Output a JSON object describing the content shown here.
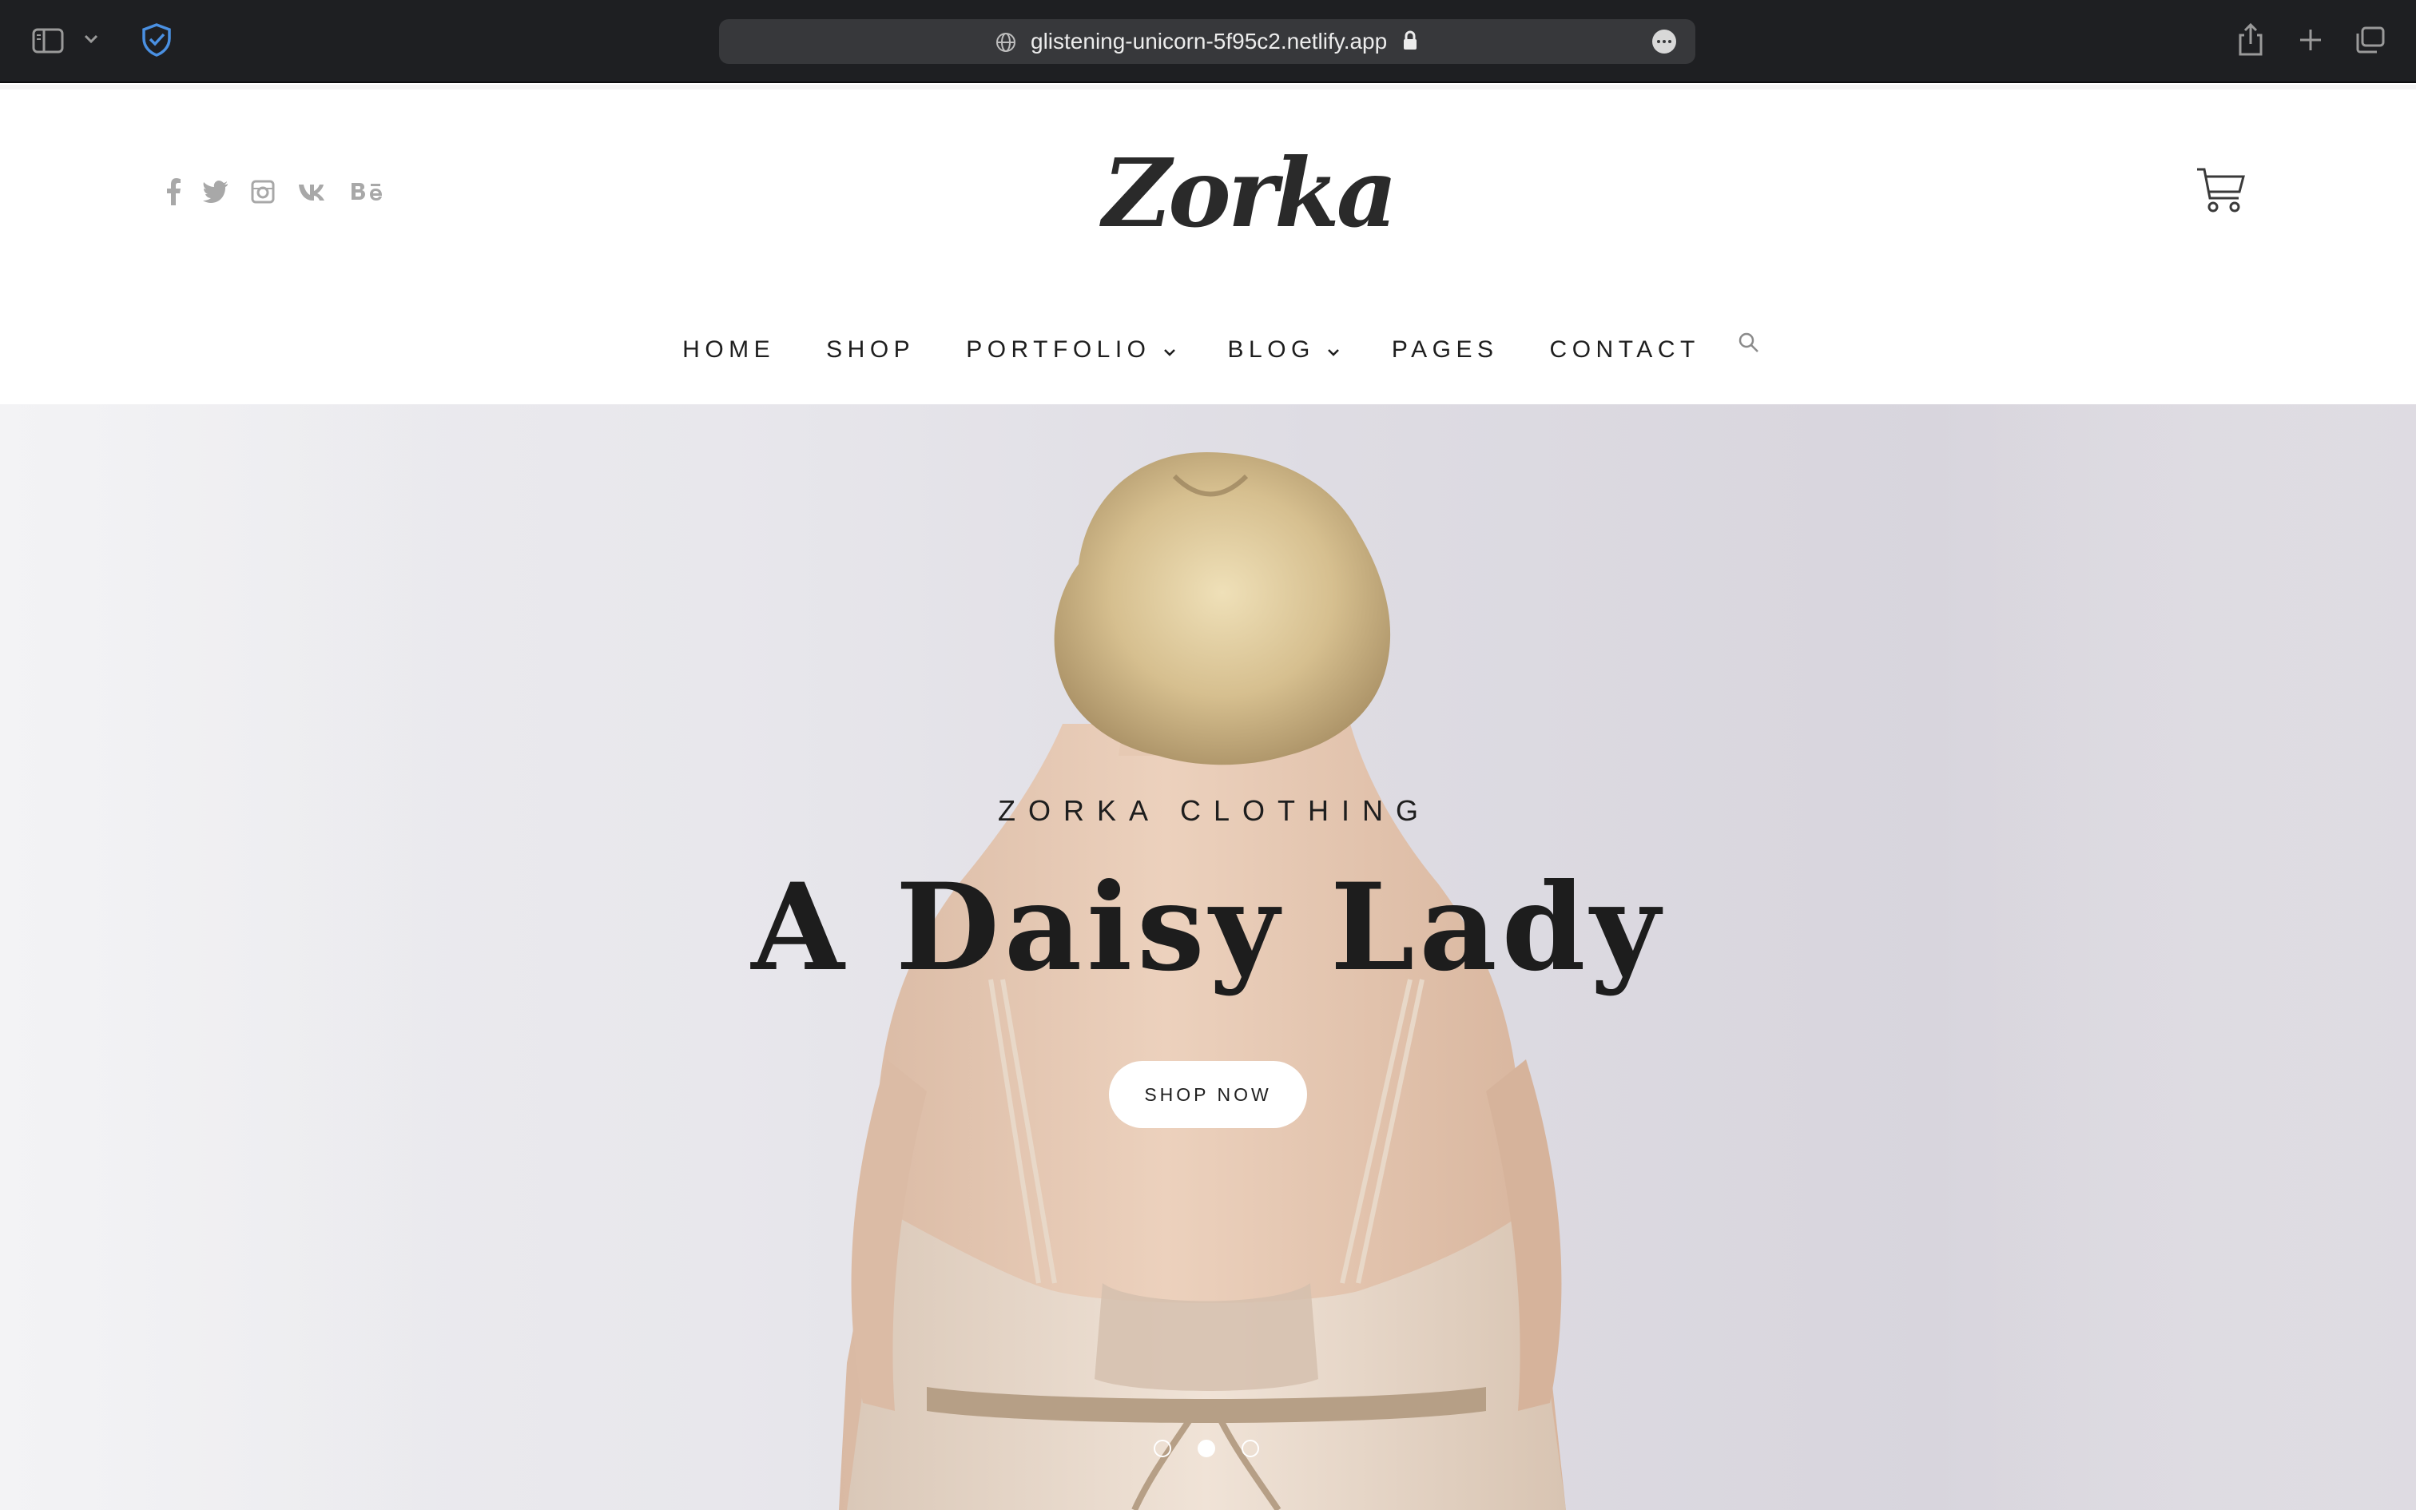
{
  "browser": {
    "url": "glistening-unicorn-5f95c2.netlify.app",
    "icons": [
      "sidebar-icon",
      "chevron-down-icon",
      "shield-check-icon",
      "globe-icon",
      "lock-icon",
      "more-icon",
      "share-icon",
      "new-tab-icon",
      "tabs-icon"
    ]
  },
  "header": {
    "logo": "Zorka",
    "socials": [
      {
        "name": "facebook-icon",
        "glyph": "f"
      },
      {
        "name": "twitter-icon",
        "glyph": "🐦"
      },
      {
        "name": "instagram-icon",
        "glyph": "◻"
      },
      {
        "name": "vk-icon",
        "glyph": "vk"
      },
      {
        "name": "behance-icon",
        "glyph": "Bē"
      }
    ],
    "cart_icon": "cart-icon"
  },
  "nav": {
    "items": [
      {
        "label": "HOME",
        "has_dropdown": false
      },
      {
        "label": "SHOP",
        "has_dropdown": false
      },
      {
        "label": "PORTFOLIO",
        "has_dropdown": true
      },
      {
        "label": "BLOG",
        "has_dropdown": true
      },
      {
        "label": "PAGES",
        "has_dropdown": false
      },
      {
        "label": "CONTACT",
        "has_dropdown": false
      }
    ],
    "search_icon": "search-icon"
  },
  "hero": {
    "eyebrow": "ZORKA CLOTHING",
    "headline": "A Daisy Lady",
    "cta": "SHOP NOW",
    "slides_total": 3,
    "active_slide": 2
  },
  "colors": {
    "chrome_bg": "#1e1f22",
    "text_dark": "#1e1e1e",
    "social_gray": "#a8a8a8",
    "hero_bg": "#e7e6ec",
    "accent_blue": "#4a90e2"
  }
}
